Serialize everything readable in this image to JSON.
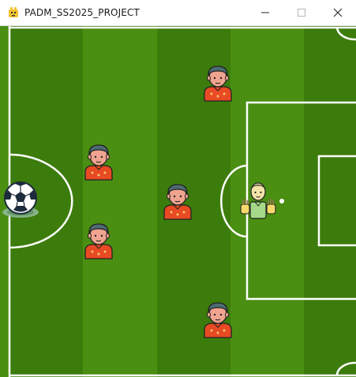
{
  "window": {
    "title": "PADM_SS2025_PROJECT",
    "app_icon": "python-icon",
    "controls": [
      "minimize-icon",
      "maximize-icon",
      "close-icon"
    ]
  },
  "game": {
    "scene": "soccer-pitch",
    "colors": {
      "grass_light": "#4a8f12",
      "grass_dark": "#3c7c0c",
      "lines": "#ffffff",
      "player_shirt": "#e84a23",
      "player_skin": "#f0a490",
      "player_hair": "#4d6b72",
      "goalkeeper_shirt": "#a6d987",
      "goalkeeper_skin": "#f2e3a8"
    },
    "entities": {
      "ball": {
        "type": "soccer-ball"
      },
      "goalkeeper": {
        "type": "goalkeeper",
        "gloves": "raised"
      },
      "players": [
        {
          "type": "defender",
          "id": 1
        },
        {
          "type": "defender",
          "id": 2
        },
        {
          "type": "defender",
          "id": 3
        },
        {
          "type": "defender",
          "id": 4
        },
        {
          "type": "defender",
          "id": 5
        }
      ]
    }
  }
}
